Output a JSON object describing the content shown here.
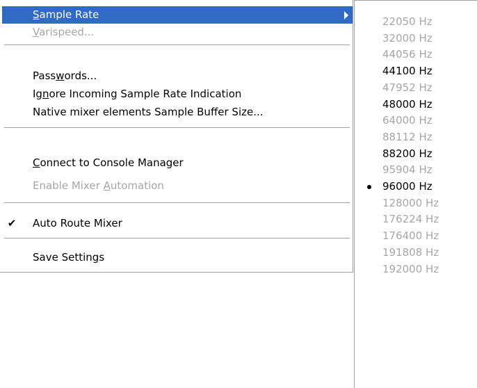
{
  "main_menu": {
    "sample_rate": {
      "prefix": "",
      "accel": "S",
      "rest": "ample Rate"
    },
    "varispeed": {
      "prefix": "",
      "accel": "V",
      "rest": "arispeed..."
    },
    "passwords": {
      "prefix": "Pass",
      "accel": "w",
      "rest": "ords..."
    },
    "ignore_incoming": {
      "prefix": "Ig",
      "accel": "n",
      "rest": "ore Incoming Sample Rate Indication"
    },
    "native_mixer": {
      "label": "Native mixer elements Sample Buffer Size..."
    },
    "connect_console": {
      "prefix": "",
      "accel": "C",
      "rest": "onnect to Console Manager"
    },
    "enable_automation": {
      "prefix": "Enable Mixer ",
      "accel": "A",
      "rest": "utomation"
    },
    "auto_route": {
      "label": "Auto Route Mixer",
      "check": "✔"
    },
    "save_settings": {
      "prefix": "Save Settin",
      "accel": "g",
      "rest": "s"
    }
  },
  "sample_rates": [
    {
      "label": "22050 Hz",
      "enabled": false,
      "selected": false
    },
    {
      "label": "32000 Hz",
      "enabled": false,
      "selected": false
    },
    {
      "label": "44056 Hz",
      "enabled": false,
      "selected": false
    },
    {
      "label": "44100 Hz",
      "enabled": true,
      "selected": false
    },
    {
      "label": "47952 Hz",
      "enabled": false,
      "selected": false
    },
    {
      "label": "48000 Hz",
      "enabled": true,
      "selected": false
    },
    {
      "label": "64000 Hz",
      "enabled": false,
      "selected": false
    },
    {
      "label": "88112 Hz",
      "enabled": false,
      "selected": false
    },
    {
      "label": "88200 Hz",
      "enabled": true,
      "selected": false
    },
    {
      "label": "95904 Hz",
      "enabled": false,
      "selected": false
    },
    {
      "label": "96000 Hz",
      "enabled": true,
      "selected": true
    },
    {
      "label": "128000 Hz",
      "enabled": false,
      "selected": false
    },
    {
      "label": "176224 Hz",
      "enabled": false,
      "selected": false
    },
    {
      "label": "176400 Hz",
      "enabled": false,
      "selected": false
    },
    {
      "label": "191808 Hz",
      "enabled": false,
      "selected": false
    },
    {
      "label": "192000 Hz",
      "enabled": false,
      "selected": false
    }
  ],
  "colors": {
    "highlight": "#316ac5",
    "disabled_text": "#a6a6a6",
    "border": "#a0a0a0"
  }
}
